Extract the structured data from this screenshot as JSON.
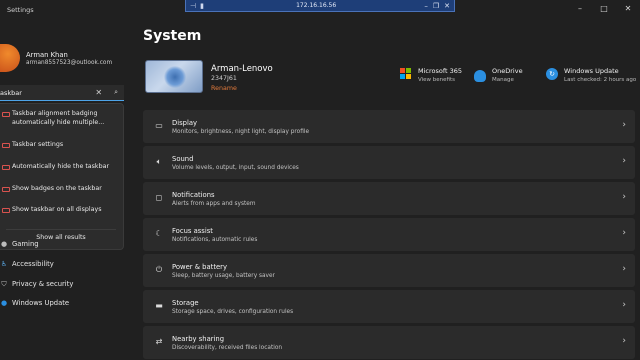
{
  "remote_bar": {
    "title": "172.16.16.56"
  },
  "window": {
    "title": "Settings",
    "controls": [
      "–",
      "□",
      "✕"
    ]
  },
  "user": {
    "name": "Arman Khan",
    "email": "arman8557523@outlook.com"
  },
  "search": {
    "value": "askbar"
  },
  "search_results": [
    {
      "label": "Taskbar alignment badging automatically hide multiple..."
    },
    {
      "label": "Taskbar settings"
    },
    {
      "label": "Automatically hide the taskbar"
    },
    {
      "label": "Show badges on the taskbar"
    },
    {
      "label": "Show taskbar on all displays"
    }
  ],
  "show_all": "Show all results",
  "nav_items": [
    {
      "label": "Gaming",
      "icon": "gaming-icon"
    },
    {
      "label": "Accessibility",
      "icon": "accessibility-icon"
    },
    {
      "label": "Privacy & security",
      "icon": "shield-icon"
    },
    {
      "label": "Windows Update",
      "icon": "windows-update-icon"
    }
  ],
  "page": {
    "title": "System"
  },
  "device": {
    "name": "Arman-Lenovo",
    "model": "2347J61",
    "rename": "Rename"
  },
  "quick_links": [
    {
      "title": "Microsoft 365",
      "sub": "View benefits",
      "icon": "microsoft-365-icon"
    },
    {
      "title": "OneDrive",
      "sub": "Manage",
      "icon": "onedrive-icon"
    },
    {
      "title": "Windows Update",
      "sub": "Last checked: 2 hours ago",
      "icon": "windows-update-icon"
    }
  ],
  "settings_rows": [
    {
      "title": "Display",
      "sub": "Monitors, brightness, night light, display profile",
      "icon": "display-icon"
    },
    {
      "title": "Sound",
      "sub": "Volume levels, output, input, sound devices",
      "icon": "speaker-icon"
    },
    {
      "title": "Notifications",
      "sub": "Alerts from apps and system",
      "icon": "bell-icon"
    },
    {
      "title": "Focus assist",
      "sub": "Notifications, automatic rules",
      "icon": "moon-icon"
    },
    {
      "title": "Power & battery",
      "sub": "Sleep, battery usage, battery saver",
      "icon": "power-icon"
    },
    {
      "title": "Storage",
      "sub": "Storage space, drives, configuration rules",
      "icon": "storage-icon"
    },
    {
      "title": "Nearby sharing",
      "sub": "Discoverability, received files location",
      "icon": "share-icon"
    }
  ],
  "colors": {
    "accent": "#4ea4e8",
    "rename": "#e0793b",
    "background": "#202020",
    "card": "#2b2b2b"
  }
}
